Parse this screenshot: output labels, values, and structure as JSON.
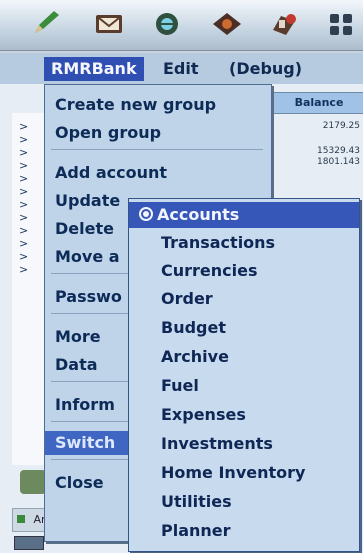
{
  "system_bar": {
    "icons": [
      "pen-icon",
      "mail-icon",
      "globe-icon",
      "eye-icon",
      "alert-icon",
      "grid-icon"
    ]
  },
  "menubar": {
    "items": [
      "RMRBank",
      "Edit",
      "(Debug)"
    ]
  },
  "background": {
    "balance_header": "Balance",
    "balances": [
      "2179.25",
      "15329.43",
      "1801.143"
    ],
    "bottom_label": "America"
  },
  "menu": {
    "items": [
      "Create new group",
      "Open group",
      "Add account",
      "Update",
      "Delete",
      "Move a",
      "Passwo",
      "More",
      "Data",
      "Inform",
      "Switch",
      "Close"
    ],
    "highlighted": "Switch"
  },
  "submenu": {
    "items": [
      "Accounts",
      "Transactions",
      "Currencies",
      "Order",
      "Budget",
      "Archive",
      "Fuel",
      "Expenses",
      "Investments",
      "Home Inventory",
      "Utilities",
      "Planner"
    ],
    "selected": "Accounts"
  }
}
